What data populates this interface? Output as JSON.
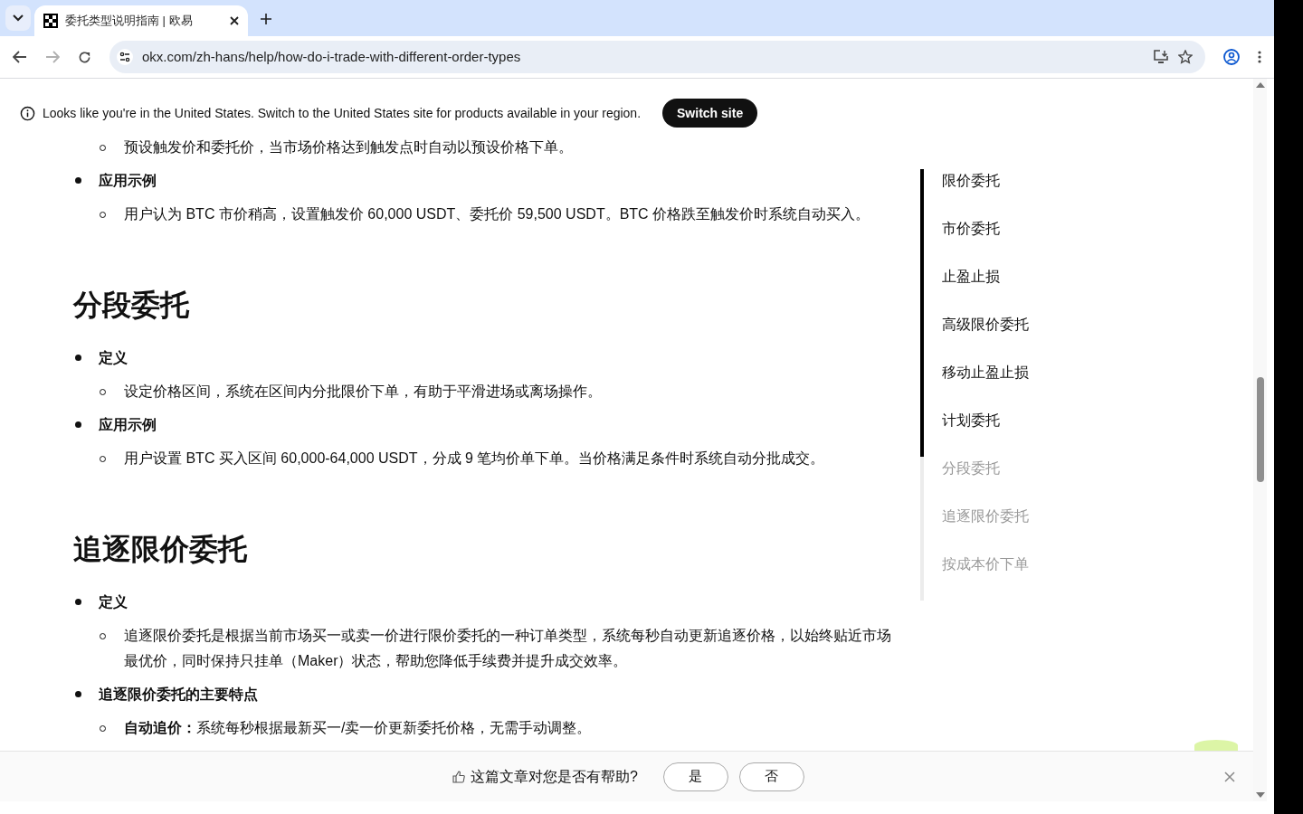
{
  "browser": {
    "tab_title": "委托类型说明指南 | 欧易",
    "url": "okx.com/zh-hans/help/how-do-i-trade-with-different-order-types"
  },
  "banner": {
    "message": "Looks like you're in the United States. Switch to the United States site for products available in your region.",
    "button": "Switch site"
  },
  "article": [
    {
      "kind": "sub",
      "text": "预设触发价和委托价，当市场价格达到触发点时自动以预设价格下单。"
    },
    {
      "kind": "bullet",
      "text": "应用示例"
    },
    {
      "kind": "sub",
      "text": "用户认为 BTC 市价稍高，设置触发价 60,000 USDT、委托价 59,500 USDT。BTC 价格跌至触发价时系统自动买入。"
    },
    {
      "kind": "heading",
      "text": "分段委托"
    },
    {
      "kind": "bullet",
      "text": "定义"
    },
    {
      "kind": "sub",
      "text": "设定价格区间，系统在区间内分批限价下单，有助于平滑进场或离场操作。"
    },
    {
      "kind": "bullet",
      "text": "应用示例"
    },
    {
      "kind": "sub",
      "text": "用户设置 BTC 买入区间 60,000-64,000 USDT，分成 9 笔均价单下单。当价格满足条件时系统自动分批成交。"
    },
    {
      "kind": "heading",
      "text": "追逐限价委托"
    },
    {
      "kind": "bullet",
      "text": "定义"
    },
    {
      "kind": "sub",
      "text": "追逐限价委托是根据当前市场买一或卖一价进行限价委托的一种订单类型，系统每秒自动更新追逐价格，以始终贴近市场最优价，同时保持只挂单（Maker）状态，帮助您降低手续费并提升成交效率。"
    },
    {
      "kind": "bullet",
      "text": "追逐限价委托的主要特点"
    },
    {
      "kind": "sub",
      "text": "**自动追价：**系统每秒根据最新买一/卖一价更新委托价格，无需手动调整。"
    }
  ],
  "toc": [
    {
      "label": "限价委托",
      "passed": true
    },
    {
      "label": "市价委托",
      "passed": true
    },
    {
      "label": "止盈止损",
      "passed": true
    },
    {
      "label": "高级限价委托",
      "passed": true
    },
    {
      "label": "移动止盈止损",
      "passed": true
    },
    {
      "label": "计划委托",
      "passed": true
    },
    {
      "label": "分段委托",
      "passed": false
    },
    {
      "label": "追逐限价委托",
      "passed": false
    },
    {
      "label": "按成本价下单",
      "passed": false
    }
  ],
  "feedback": {
    "question": "这篇文章对您是否有帮助?",
    "buttons": [
      "是",
      "否"
    ]
  }
}
